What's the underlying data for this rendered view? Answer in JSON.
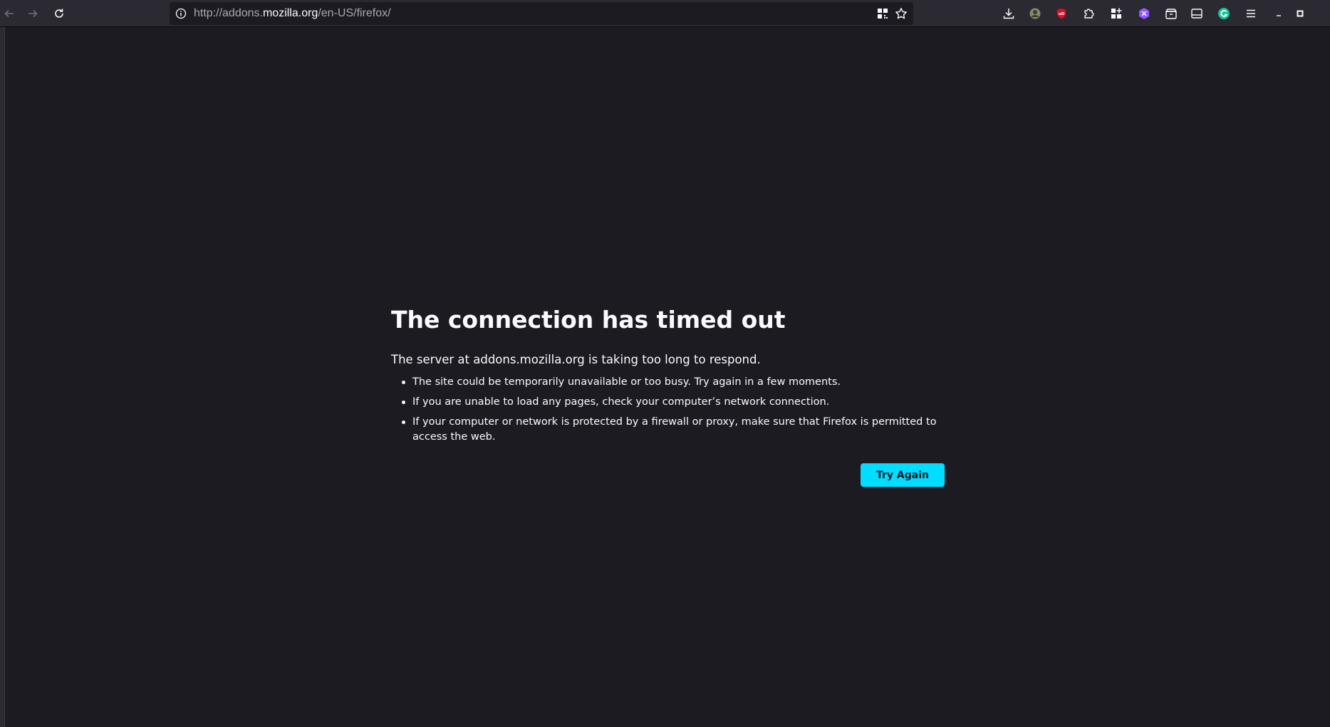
{
  "browser": {
    "url_scheme": "http://addons.",
    "url_host": "mozilla.org",
    "url_path": "/en-US/firefox/"
  },
  "toolbar_icons": [
    "downloads-icon",
    "avatar-extension-icon",
    "ublock-origin-icon",
    "extensions-icon",
    "apps-grid-icon",
    "hexagon-extension-icon",
    "container-icon",
    "sidebar-icon",
    "grammarly-icon",
    "hamburger-menu-icon",
    "minimize-icon",
    "maximize-icon"
  ],
  "colors": {
    "page_bg": "#1c1b22",
    "toolbar_bg": "#2b2a33",
    "button_bg": "#00ddff",
    "ublock_red": "#d3142e",
    "grammarly_green": "#15c39a",
    "hexagon_purple": "#9059ff"
  },
  "error": {
    "title": "The connection has timed out",
    "description": "The server at addons.mozilla.org is taking too long to respond.",
    "reasons": [
      "The site could be temporarily unavailable or too busy. Try again in a few moments.",
      "If you are unable to load any pages, check your computer’s network connection.",
      "If your computer or network is protected by a firewall or proxy, make sure that Firefox is permitted to",
      "access the web."
    ],
    "button_label": "Try Again"
  }
}
